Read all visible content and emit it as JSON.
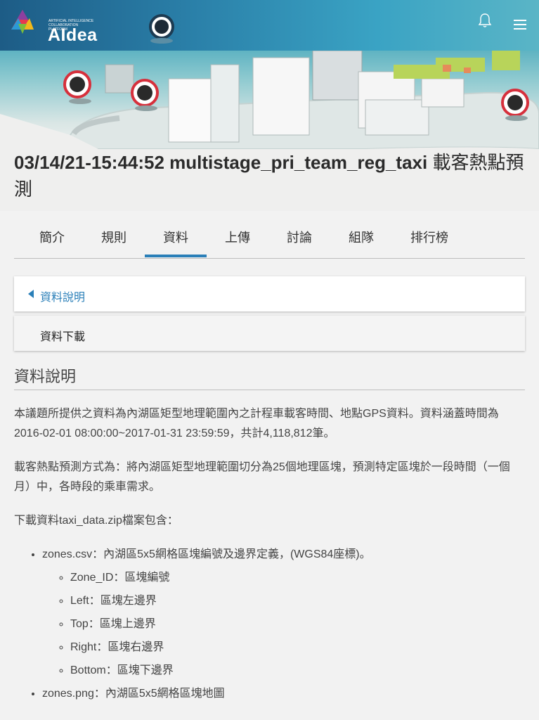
{
  "header": {
    "logo_text": "AIdea",
    "logo_subtext_line1": "ARTIFICIAL INTELLIGENCE",
    "logo_subtext_line2": "COLLABORATION PLATFORM",
    "bell_icon": "bell-icon",
    "menu_icon": "hamburger-menu-icon"
  },
  "page": {
    "title_bold": "03/14/21-15:44:52 multistage_pri_team_reg_taxi",
    "title_rest": " 載客熱點預測"
  },
  "tabs": [
    {
      "label": "簡介"
    },
    {
      "label": "規則"
    },
    {
      "label": "資料",
      "active": true
    },
    {
      "label": "上傳"
    },
    {
      "label": "討論"
    },
    {
      "label": "組隊"
    },
    {
      "label": "排行榜"
    }
  ],
  "accordion": [
    {
      "label": "資料說明",
      "active": true
    },
    {
      "label": "資料下載"
    }
  ],
  "content": {
    "heading": "資料說明",
    "p1": "本議題所提供之資料為內湖區矩型地理範圍內之計程車載客時間、地點GPS資料。資料涵蓋時間為2016-02-01 08:00:00~2017-01-31 23:59:59，共計4,118,812筆。",
    "p2": "載客熱點預測方式為：將內湖區矩型地理範圍切分為25個地理區塊，預測特定區塊於一段時間（一個月）中，各時段的乘車需求。",
    "p3": "下載資料taxi_data.zip檔案包含：",
    "list": [
      {
        "text": "zones.csv：內湖區5x5網格區塊編號及邊界定義，(WGS84座標)。",
        "children": [
          "Zone_ID：區塊編號",
          "Left：區塊左邊界",
          "Top：區塊上邊界",
          "Right：區塊右邊界",
          "Bottom：區塊下邊界"
        ]
      },
      {
        "text": "zones.png：內湖區5x5網格區塊地圖"
      }
    ]
  },
  "colors": {
    "accent": "#2a7fb8",
    "header_start": "#1d5c86",
    "header_end": "#5ab5c6",
    "background": "#f2f2f2"
  }
}
